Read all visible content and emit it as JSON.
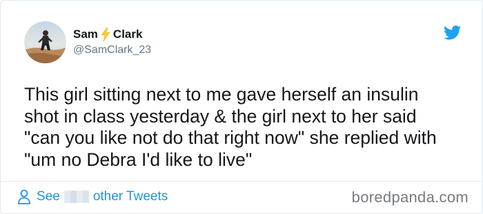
{
  "tweet": {
    "author": {
      "first_name": "Sam",
      "last_name": "Clark",
      "handle": "@SamClark_23"
    },
    "text": "This girl sitting next to me gave herself an insulin\nshot in class yesterday & the girl next to her said\n\"can you like not do that right now\" she replied with\n\"um no Debra I'd like to live\""
  },
  "footer": {
    "see_label": "See",
    "other_tweets_label": "other Tweets"
  },
  "watermark": {
    "text": "boredpanda.com"
  },
  "colors": {
    "accent": "#1b95e0",
    "twitter_blue": "#1da1f2",
    "bolt": "#f5d02d",
    "text": "#14171a",
    "muted": "#657786"
  },
  "icons": {
    "bird": "twitter-bird-icon",
    "bolt": "lightning-bolt-icon",
    "person": "person-icon"
  }
}
